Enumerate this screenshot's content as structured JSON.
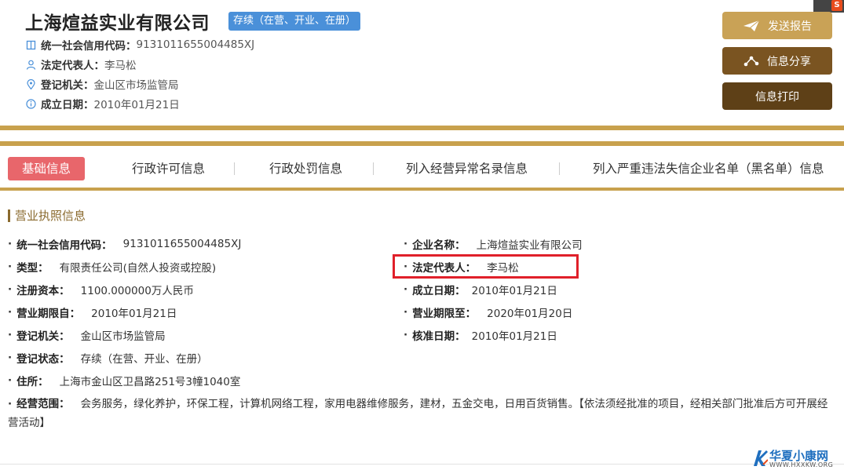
{
  "header": {
    "company_name": "上海煊益实业有限公司",
    "status": "存续（在营、开业、在册）",
    "credit_code_label": "统一社会信用代码：",
    "credit_code": "9131011655004485XJ",
    "legal_rep_label": "法定代表人：",
    "legal_rep": "李马松",
    "authority_label": "登记机关：",
    "authority": "金山区市场监管局",
    "established_label": "成立日期：",
    "established": "2010年01月21日"
  },
  "actions": {
    "send_report": "发送报告",
    "share": "信息分享",
    "print": "信息打印"
  },
  "tabs": [
    {
      "label": "基础信息"
    },
    {
      "label": "行政许可信息"
    },
    {
      "label": "行政处罚信息"
    },
    {
      "label": "列入经营异常名录信息"
    },
    {
      "label": "列入严重违法失信企业名单（黑名单）信息"
    }
  ],
  "section": {
    "title": "营业执照信息",
    "bullet": "·",
    "left": [
      {
        "label": "统一社会信用代码：",
        "value": "9131011655004485XJ"
      },
      {
        "label": "类型：",
        "value": "有限责任公司(自然人投资或控股)"
      },
      {
        "label": "注册资本：",
        "value": "1100.000000万人民币"
      },
      {
        "label": "营业期限自：",
        "value": "2010年01月21日"
      },
      {
        "label": "登记机关：",
        "value": "金山区市场监管局"
      },
      {
        "label": "登记状态：",
        "value": "存续（在营、开业、在册）"
      },
      {
        "label": "住所：",
        "value": "上海市金山区卫昌路251号3幢1040室"
      }
    ],
    "right": [
      {
        "label": "企业名称：",
        "value": "上海煊益实业有限公司"
      },
      {
        "label": "法定代表人：",
        "value": "李马松"
      },
      {
        "label": "成立日期：",
        "value": "2010年01月21日"
      },
      {
        "label": "营业期限至：",
        "value": "2020年01月20日"
      },
      {
        "label": "核准日期：",
        "value": "2010年01月21日"
      }
    ],
    "scope_label": "经营范围：",
    "scope_value": "会务服务，绿化养护，环保工程，计算机网络工程，家用电器维修服务，建材，五金交电，日用百货销售。【依法须经批准的项目，经相关部门批准后方可开展经营活动】"
  },
  "watermark": {
    "name": "华夏小康网",
    "url": "WWW.HXXKW.ORG"
  },
  "corner_logo": "S",
  "colors": {
    "gold": "#c8a14d",
    "status_blue": "#4a90d9",
    "active_tab": "#e8666b",
    "highlight_red": "#e0202a"
  }
}
